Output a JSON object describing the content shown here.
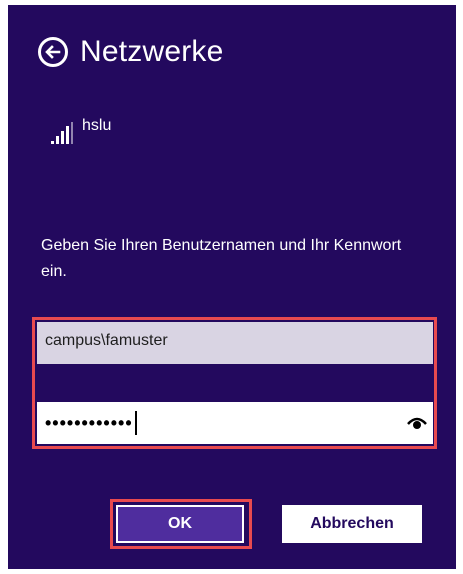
{
  "header": {
    "title": "Netzwerke",
    "back_icon": "back-arrow-circle-icon"
  },
  "network": {
    "name": "hslu",
    "signal_icon": "wifi-signal-bars-icon",
    "signal_bars": 4
  },
  "prompt": {
    "text": "Geben Sie Ihren Benutzernamen und Ihr Kennwort ein."
  },
  "form": {
    "username_value": "campus\\famuster",
    "password_mask": "••••••••••••",
    "reveal_icon": "eye-icon"
  },
  "buttons": {
    "ok_label": "OK",
    "cancel_label": "Abbrechen"
  },
  "colors": {
    "panel_bg": "#23095e",
    "accent_button": "#4f2d9e",
    "highlight_frame": "#e84a4f"
  }
}
